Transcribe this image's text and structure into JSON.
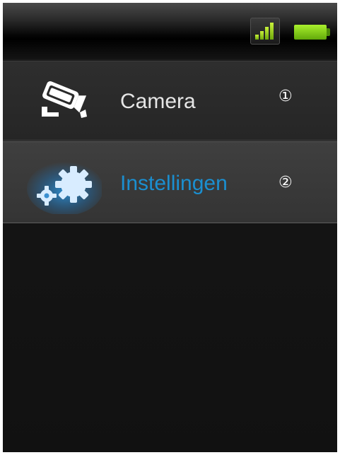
{
  "status_bar": {
    "signal_icon": "signal-strength-icon",
    "battery_icon": "battery-icon",
    "battery_level": 1.0,
    "signal_level": 4,
    "accent_color": "#8ed41c"
  },
  "menu": {
    "items": [
      {
        "label": "Camera",
        "number": "①",
        "icon": "camera-icon",
        "selected": false,
        "text_color": "#e6e6e6"
      },
      {
        "label": "Instellingen",
        "number": "②",
        "icon": "gears-icon",
        "selected": true,
        "text_color": "#1b8fd0"
      }
    ]
  }
}
